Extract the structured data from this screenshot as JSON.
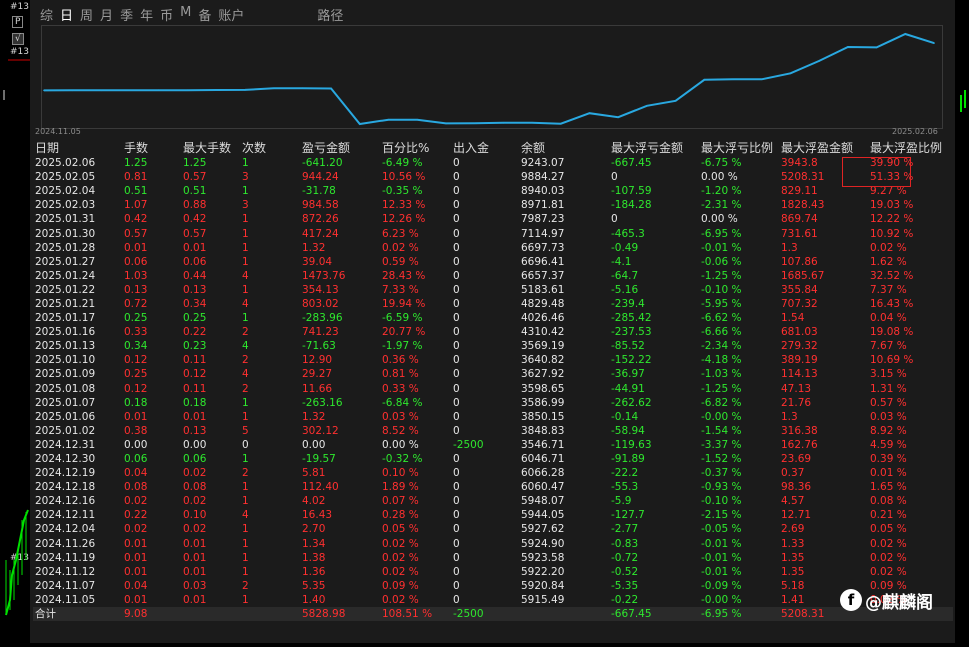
{
  "left_strip": {
    "tag1": "#13",
    "tag2": "P",
    "tag3": "√",
    "tag4": "#13",
    "tag5": "#13"
  },
  "tabs": [
    "综",
    "日",
    "周",
    "月",
    "季",
    "年",
    "币",
    "M",
    "备",
    "账户",
    "路径"
  ],
  "active_tab": 1,
  "colors": {
    "line": "#29a8e0",
    "positive": "#2ee82e",
    "negative": "#ff3030",
    "highlight": "#e02424"
  },
  "chart": {
    "start_date": "2024.11.05",
    "end_date": "2025.02.06"
  },
  "chart_data": {
    "type": "line",
    "x": [
      "2024.11.05",
      "2024.11.07",
      "2024.11.12",
      "2024.11.19",
      "2024.11.26",
      "2024.12.04",
      "2024.12.11",
      "2024.12.16",
      "2024.12.18",
      "2024.12.19",
      "2024.12.30",
      "2024.12.31",
      "2025.01.02",
      "2025.01.06",
      "2025.01.07",
      "2025.01.08",
      "2025.01.09",
      "2025.01.10",
      "2025.01.13",
      "2025.01.16",
      "2025.01.17",
      "2025.01.21",
      "2025.01.22",
      "2025.01.24",
      "2025.01.27",
      "2025.01.28",
      "2025.01.30",
      "2025.01.31",
      "2025.02.03",
      "2025.02.04",
      "2025.02.05",
      "2025.02.06"
    ],
    "series": [
      {
        "values": [
          5915.49,
          5920.84,
          5922.2,
          5923.58,
          5924.9,
          5927.62,
          5944.05,
          5948.07,
          6060.47,
          6066.28,
          6046.71,
          3546.71,
          3848.83,
          3850.15,
          3586.99,
          3598.65,
          3627.92,
          3640.82,
          3569.19,
          4310.42,
          4026.46,
          4829.48,
          5183.61,
          6657.37,
          6696.41,
          6697.73,
          7114.97,
          7987.23,
          8971.81,
          8940.03,
          9884.27,
          9243.07
        ]
      }
    ],
    "xlabel": "",
    "ylabel": ""
  },
  "table": {
    "headers": [
      "日期",
      "手数",
      "最大手数",
      "次数",
      "盈亏金额",
      "百分比%",
      "出入金",
      "余额",
      "最大浮亏金额",
      "最大浮亏比例",
      "最大浮盈金额",
      "最大浮盈比例"
    ],
    "rows": [
      [
        "2025.02.06",
        "1.25",
        "1.25",
        "1",
        "-641.20",
        "-6.49 %",
        "0",
        "9243.07",
        "-667.45",
        "-6.75 %",
        "3943.8",
        "39.90 %"
      ],
      [
        "2025.02.05",
        "0.81",
        "0.57",
        "3",
        "944.24",
        "10.56 %",
        "0",
        "9884.27",
        "0",
        "0.00 %",
        "5208.31",
        "51.33 %"
      ],
      [
        "2025.02.04",
        "0.51",
        "0.51",
        "1",
        "-31.78",
        "-0.35 %",
        "0",
        "8940.03",
        "-107.59",
        "-1.20 %",
        "829.11",
        "9.27 %"
      ],
      [
        "2025.02.03",
        "1.07",
        "0.88",
        "3",
        "984.58",
        "12.33 %",
        "0",
        "8971.81",
        "-184.28",
        "-2.31 %",
        "1828.43",
        "19.03 %"
      ],
      [
        "2025.01.31",
        "0.42",
        "0.42",
        "1",
        "872.26",
        "12.26 %",
        "0",
        "7987.23",
        "0",
        "0.00 %",
        "869.74",
        "12.22 %"
      ],
      [
        "2025.01.30",
        "0.57",
        "0.57",
        "1",
        "417.24",
        "6.23 %",
        "0",
        "7114.97",
        "-465.3",
        "-6.95 %",
        "731.61",
        "10.92 %"
      ],
      [
        "2025.01.28",
        "0.01",
        "0.01",
        "1",
        "1.32",
        "0.02 %",
        "0",
        "6697.73",
        "-0.49",
        "-0.01 %",
        "1.3",
        "0.02 %"
      ],
      [
        "2025.01.27",
        "0.06",
        "0.06",
        "1",
        "39.04",
        "0.59 %",
        "0",
        "6696.41",
        "-4.1",
        "-0.06 %",
        "107.86",
        "1.62 %"
      ],
      [
        "2025.01.24",
        "1.03",
        "0.44",
        "4",
        "1473.76",
        "28.43 %",
        "0",
        "6657.37",
        "-64.7",
        "-1.25 %",
        "1685.67",
        "32.52 %"
      ],
      [
        "2025.01.22",
        "0.13",
        "0.13",
        "1",
        "354.13",
        "7.33 %",
        "0",
        "5183.61",
        "-5.16",
        "-0.10 %",
        "355.84",
        "7.37 %"
      ],
      [
        "2025.01.21",
        "0.72",
        "0.34",
        "4",
        "803.02",
        "19.94 %",
        "0",
        "4829.48",
        "-239.4",
        "-5.95 %",
        "707.32",
        "16.43 %"
      ],
      [
        "2025.01.17",
        "0.25",
        "0.25",
        "1",
        "-283.96",
        "-6.59 %",
        "0",
        "4026.46",
        "-285.42",
        "-6.62 %",
        "1.54",
        "0.04 %"
      ],
      [
        "2025.01.16",
        "0.33",
        "0.22",
        "2",
        "741.23",
        "20.77 %",
        "0",
        "4310.42",
        "-237.53",
        "-6.66 %",
        "681.03",
        "19.08 %"
      ],
      [
        "2025.01.13",
        "0.34",
        "0.23",
        "4",
        "-71.63",
        "-1.97 %",
        "0",
        "3569.19",
        "-85.52",
        "-2.34 %",
        "279.32",
        "7.67 %"
      ],
      [
        "2025.01.10",
        "0.12",
        "0.11",
        "2",
        "12.90",
        "0.36 %",
        "0",
        "3640.82",
        "-152.22",
        "-4.18 %",
        "389.19",
        "10.69 %"
      ],
      [
        "2025.01.09",
        "0.25",
        "0.12",
        "4",
        "29.27",
        "0.81 %",
        "0",
        "3627.92",
        "-36.97",
        "-1.03 %",
        "114.13",
        "3.15 %"
      ],
      [
        "2025.01.08",
        "0.12",
        "0.11",
        "2",
        "11.66",
        "0.33 %",
        "0",
        "3598.65",
        "-44.91",
        "-1.25 %",
        "47.13",
        "1.31 %"
      ],
      [
        "2025.01.07",
        "0.18",
        "0.18",
        "1",
        "-263.16",
        "-6.84 %",
        "0",
        "3586.99",
        "-262.62",
        "-6.82 %",
        "21.76",
        "0.57 %"
      ],
      [
        "2025.01.06",
        "0.01",
        "0.01",
        "1",
        "1.32",
        "0.03 %",
        "0",
        "3850.15",
        "-0.14",
        "-0.00 %",
        "1.3",
        "0.03 %"
      ],
      [
        "2025.01.02",
        "0.38",
        "0.13",
        "5",
        "302.12",
        "8.52 %",
        "0",
        "3848.83",
        "-58.94",
        "-1.54 %",
        "316.38",
        "8.92 %"
      ],
      [
        "2024.12.31",
        "0.00",
        "0.00",
        "0",
        "0.00",
        "0.00 %",
        "-2500",
        "3546.71",
        "-119.63",
        "-3.37 %",
        "162.76",
        "4.59 %"
      ],
      [
        "2024.12.30",
        "0.06",
        "0.06",
        "1",
        "-19.57",
        "-0.32 %",
        "0",
        "6046.71",
        "-91.89",
        "-1.52 %",
        "23.69",
        "0.39 %"
      ],
      [
        "2024.12.19",
        "0.04",
        "0.02",
        "2",
        "5.81",
        "0.10 %",
        "0",
        "6066.28",
        "-22.2",
        "-0.37 %",
        "0.37",
        "0.01 %"
      ],
      [
        "2024.12.18",
        "0.08",
        "0.08",
        "1",
        "112.40",
        "1.89 %",
        "0",
        "6060.47",
        "-55.3",
        "-0.93 %",
        "98.36",
        "1.65 %"
      ],
      [
        "2024.12.16",
        "0.02",
        "0.02",
        "1",
        "4.02",
        "0.07 %",
        "0",
        "5948.07",
        "-5.9",
        "-0.10 %",
        "4.57",
        "0.08 %"
      ],
      [
        "2024.12.11",
        "0.22",
        "0.10",
        "4",
        "16.43",
        "0.28 %",
        "0",
        "5944.05",
        "-127.7",
        "-2.15 %",
        "12.71",
        "0.21 %"
      ],
      [
        "2024.12.04",
        "0.02",
        "0.02",
        "1",
        "2.70",
        "0.05 %",
        "0",
        "5927.62",
        "-2.77",
        "-0.05 %",
        "2.69",
        "0.05 %"
      ],
      [
        "2024.11.26",
        "0.01",
        "0.01",
        "1",
        "1.34",
        "0.02 %",
        "0",
        "5924.90",
        "-0.83",
        "-0.01 %",
        "1.33",
        "0.02 %"
      ],
      [
        "2024.11.19",
        "0.01",
        "0.01",
        "1",
        "1.38",
        "0.02 %",
        "0",
        "5923.58",
        "-0.72",
        "-0.01 %",
        "1.35",
        "0.02 %"
      ],
      [
        "2024.11.12",
        "0.01",
        "0.01",
        "1",
        "1.36",
        "0.02 %",
        "0",
        "5922.20",
        "-0.52",
        "-0.01 %",
        "1.35",
        "0.02 %"
      ],
      [
        "2024.11.07",
        "0.04",
        "0.03",
        "2",
        "5.35",
        "0.09 %",
        "0",
        "5920.84",
        "-5.35",
        "-0.09 %",
        "5.18",
        "0.09 %"
      ],
      [
        "2024.11.05",
        "0.01",
        "0.01",
        "1",
        "1.40",
        "0.02 %",
        "0",
        "5915.49",
        "-0.22",
        "-0.00 %",
        "1.41",
        "0.02 %"
      ]
    ],
    "total": [
      "合计",
      "9.08",
      "",
      "",
      "5828.98",
      "108.51 %",
      "-2500",
      "",
      "-667.45",
      "-6.95 %",
      "5208.31",
      ""
    ]
  },
  "watermark": {
    "logo": "f",
    "text": "@麒麟阁"
  }
}
